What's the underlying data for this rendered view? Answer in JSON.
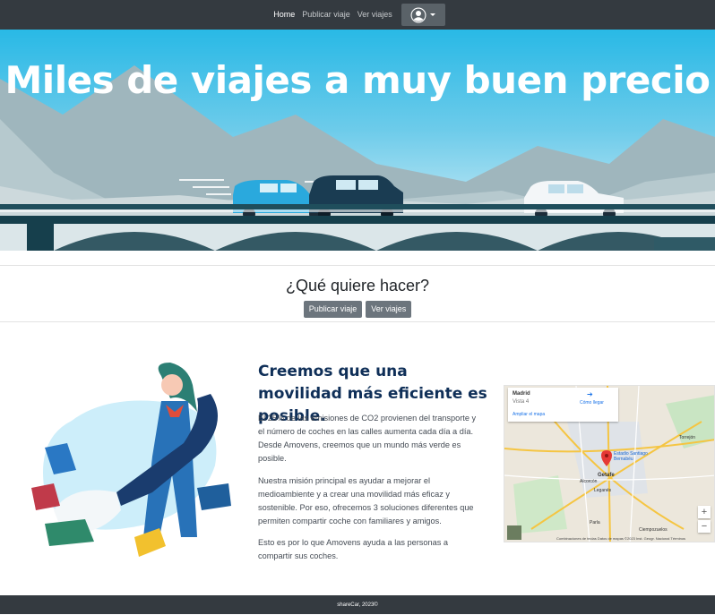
{
  "nav": {
    "links": [
      "Home",
      "Publicar viaje",
      "Ver viajes"
    ],
    "user_icon": "user-circle-icon"
  },
  "hero": {
    "title": "Miles de viajes a muy buen precio"
  },
  "question": {
    "title": "¿Qué quiere hacer?",
    "publish_button": "Publicar viaje",
    "view_button": "Ver viajes"
  },
  "about": {
    "heading": "Creemos que una movilidad más eficiente es posible.",
    "paragraphs": [
      "El 25% de las emisiones de CO2 provienen del transporte y el número de coches en las calles aumenta cada día a día. Desde Amovens, creemos que un mundo más verde es posible.",
      "Nuestra misión principal es ayudar a mejorar el medioambiente y a crear una movilidad más eficaz y sostenible. Por eso, ofrecemos 3 soluciones diferentes que permiten compartir coche con familiares y amigos.",
      "Esto es por lo que Amovens ayuda a las personas a compartir sus coches."
    ]
  },
  "map": {
    "place": "Madrid",
    "sub": "Vista 4",
    "directions": "Cómo llegar",
    "enlarge": "Ampliar el mapa",
    "labels": [
      "Getafe",
      "Estadio Santiago Bernabéu",
      "Alcorcón",
      "Leganés",
      "Parla",
      "Torrejón",
      "Ciempozuelos"
    ],
    "zoom_in": "+",
    "zoom_out": "−",
    "attribution": "Combinaciones de teclas   Datos de mapas ©2023 Inst. Geogr. Nacional   Términos"
  },
  "footer": {
    "text": "shareCar, 2023©"
  },
  "colors": {
    "navbar": "#343a40",
    "sky": "#29b9e6",
    "heading": "#0f2f58",
    "button": "#6c757d"
  }
}
